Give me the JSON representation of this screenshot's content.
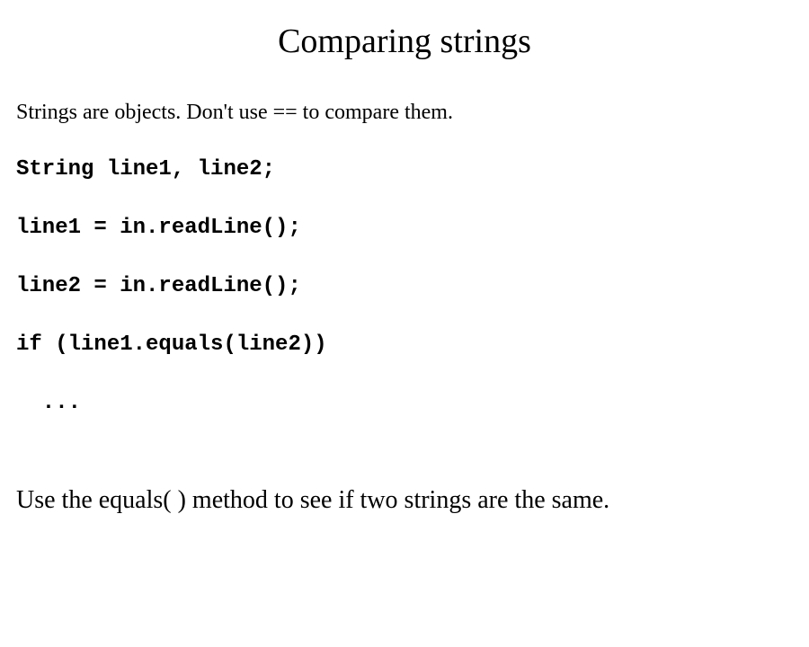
{
  "title": "Comparing strings",
  "intro": "Strings are objects. Don't use == to compare them.",
  "code": {
    "l1": "String line1, line2;",
    "l2": "line1 = in.readLine();",
    "l3": "line2 = in.readLine();",
    "l4": "if (line1.equals(line2))",
    "l5": "  ..."
  },
  "conclusion": "Use the equals( ) method to see if two strings are the same."
}
